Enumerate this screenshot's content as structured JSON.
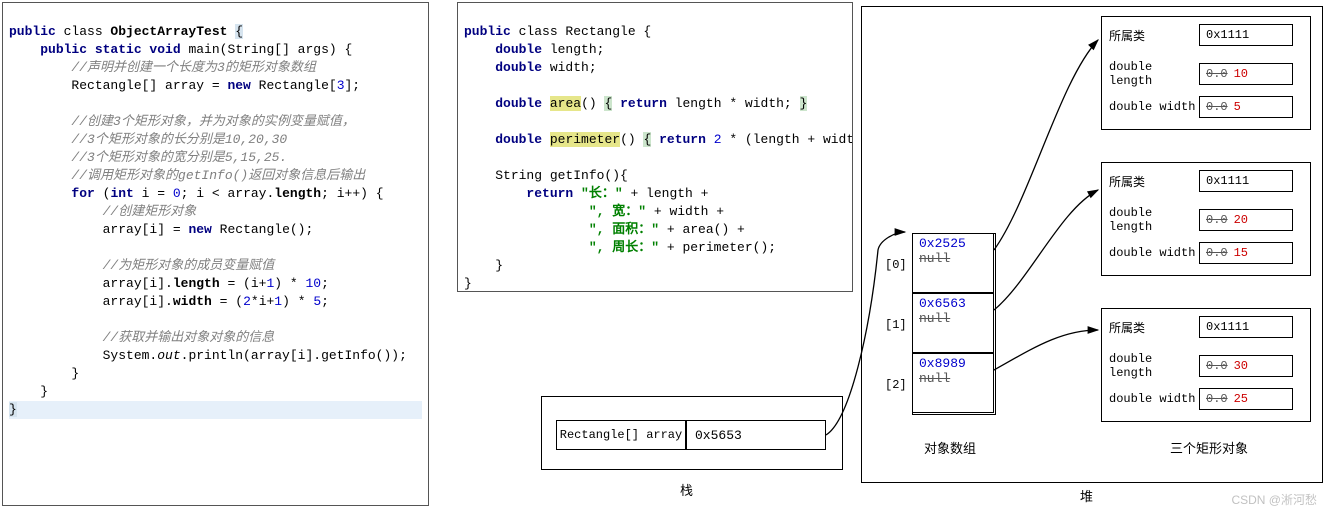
{
  "code1": {
    "l0a": "public",
    "l0b": " class ",
    "l0c": "ObjectArrayTest ",
    "l0d": "{",
    "l1a": "public static void",
    "l1b": " main(String[] args) {",
    "l2": "//声明并创建一个长度为3的矩形对象数组",
    "l3a": "Rectangle[] array = ",
    "l3b": "new",
    "l3c": " Rectangle[",
    "l3d": "3",
    "l3e": "];",
    "l4": "//创建3个矩形对象，并为对象的实例变量赋值，",
    "l5": "//3个矩形对象的长分别是10,20,30",
    "l6": "//3个矩形对象的宽分别是5,15,25.",
    "l7": "//调用矩形对象的getInfo()返回对象信息后输出",
    "l8a": "for",
    "l8b": " (",
    "l8c": "int",
    "l8d": " i = ",
    "l8e": "0",
    "l8f": "; i < array.",
    "l8g": "length",
    "l8h": "; i++) {",
    "l9": "//创建矩形对象",
    "l10a": "array[i] = ",
    "l10b": "new",
    "l10c": " Rectangle();",
    "l11": "//为矩形对象的成员变量赋值",
    "l12a": "array[i].",
    "l12b": "length",
    "l12c": " = (i+",
    "l12d": "1",
    "l12e": ") * ",
    "l12f": "10",
    "l12g": ";",
    "l13a": "array[i].",
    "l13b": "width",
    "l13c": " = (",
    "l13d": "2",
    "l13e": "*i+",
    "l13f": "1",
    "l13g": ") * ",
    "l13h": "5",
    "l13i": ";",
    "l14": "//获取并输出对象对象的信息",
    "l15a": "System.",
    "l15b": "out",
    "l15c": ".println(array[i].getInfo());",
    "l16": "}",
    "l17": "}",
    "l18": "}"
  },
  "code2": {
    "l0a": "public",
    "l0b": " class Rectangle {",
    "l1a": "double",
    "l1b": " length;",
    "l2a": "double",
    "l2b": " width;",
    "l3a": "double",
    "l3b": " ",
    "l3c": "area",
    "l3d": "() ",
    "l3e": "{",
    "l3f": " ",
    "l3g": "return",
    "l3h": " length * width; ",
    "l3i": "}",
    "l4a": "double",
    "l4b": " ",
    "l4c": "perimeter",
    "l4d": "() ",
    "l4e": "{",
    "l4f": " ",
    "l4g": "return",
    "l4h": " ",
    "l4i": "2",
    "l4j": " * (length + width); ",
    "l4k": "}",
    "l5": "String getInfo(){",
    "l6a": "return ",
    "l6b": "\"长：\"",
    "l6c": " + length +",
    "l7a": "\", 宽：\"",
    "l7b": " + width +",
    "l8a": "\", 面积：\"",
    "l8b": " + area() +",
    "l9a": "\", 周长：\"",
    "l9b": " + perimeter();",
    "l10": "}",
    "l11": "}"
  },
  "stack": {
    "var": "Rectangle[]  array",
    "val": "0x5653",
    "label": "栈"
  },
  "heap": {
    "label": "堆",
    "array_label": "对象数组",
    "rects_label": "三个矩形对象",
    "idx": [
      "[0]",
      "[1]",
      "[2]"
    ],
    "addr": [
      "0x2525",
      "0x6563",
      "0x8989"
    ],
    "null": "null",
    "rect": [
      {
        "cls_lbl": "所属类",
        "cls": "0x1111",
        "len_lbl": "double length",
        "len_old": "0.0",
        "len_new": "10",
        "wid_lbl": "double width",
        "wid_old": "0.0",
        "wid_new": "5"
      },
      {
        "cls_lbl": "所属类",
        "cls": "0x1111",
        "len_lbl": "double length",
        "len_old": "0.0",
        "len_new": "20",
        "wid_lbl": "double width",
        "wid_old": "0.0",
        "wid_new": "15"
      },
      {
        "cls_lbl": "所属类",
        "cls": "0x1111",
        "len_lbl": "double length",
        "len_old": "0.0",
        "len_new": "30",
        "wid_lbl": "double width",
        "wid_old": "0.0",
        "wid_new": "25"
      }
    ]
  },
  "watermark": "CSDN @淅河愁"
}
